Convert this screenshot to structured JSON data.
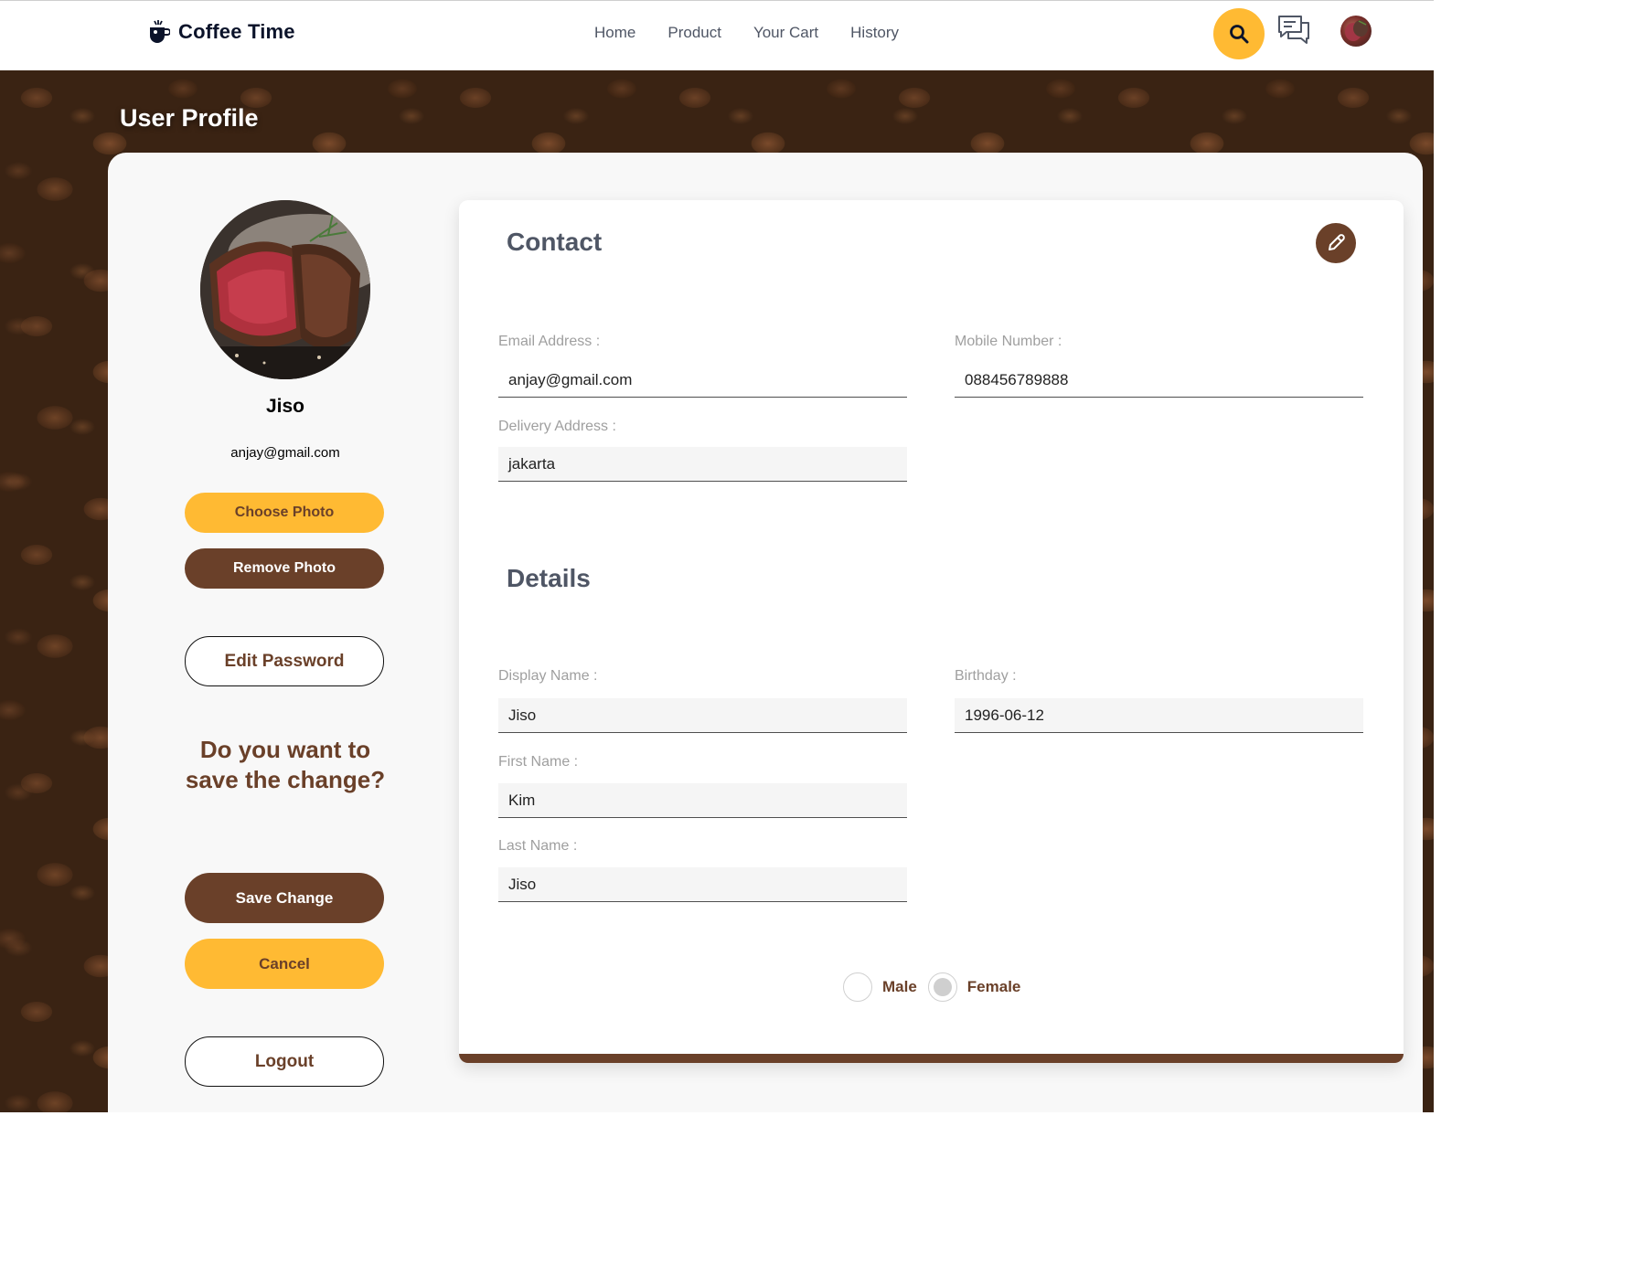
{
  "brand": {
    "name": "Coffee Time",
    "icon": "coffee-cup-icon"
  },
  "nav": {
    "links": [
      "Home",
      "Product",
      "Your Cart",
      "History"
    ]
  },
  "header_icons": {
    "search": "search-icon",
    "chat": "chat-icon",
    "avatar": "user-avatar"
  },
  "colors": {
    "accent": "#ffba33",
    "brand_brown": "#6a4029",
    "heading": "#4f5665",
    "label": "#9f9f9f"
  },
  "page": {
    "title": "User Profile"
  },
  "profile": {
    "name": "Jiso",
    "email": "anjay@gmail.com",
    "choose_photo": "Choose Photo",
    "remove_photo": "Remove Photo",
    "edit_password": "Edit Password",
    "save_question": "Do you want to save the change?",
    "save_change": "Save Change",
    "cancel": "Cancel",
    "logout": "Logout"
  },
  "contact": {
    "title": "Contact",
    "edit_icon": "pencil-icon",
    "email_label": "Email Address :",
    "email_value": "anjay@gmail.com",
    "mobile_label": "Mobile Number :",
    "mobile_value": "088456789888",
    "address_label": "Delivery Address :",
    "address_value": "jakarta"
  },
  "details": {
    "title": "Details",
    "display_name_label": "Display Name :",
    "display_name_value": "Jiso",
    "birthday_label": "Birthday :",
    "birthday_value": "1996-06-12",
    "first_name_label": "First Name :",
    "first_name_value": "Kim",
    "last_name_label": "Last Name :",
    "last_name_value": "Jiso",
    "gender_options": [
      "Male",
      "Female"
    ],
    "gender_selected": "Female"
  }
}
